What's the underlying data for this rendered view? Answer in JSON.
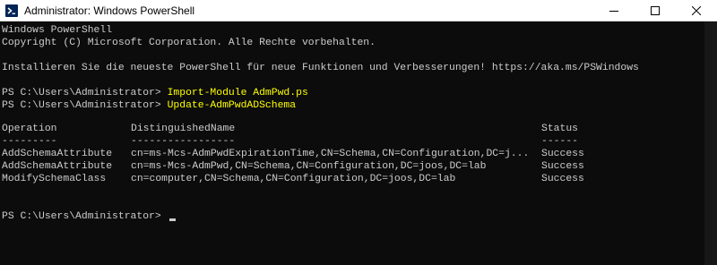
{
  "window": {
    "title": "Administrator: Windows PowerShell",
    "icon": "powershell-icon",
    "controls": [
      "minimize-icon",
      "maximize-icon",
      "close-icon"
    ]
  },
  "colors": {
    "background": "#0c0c0c",
    "text": "#cccccc",
    "command": "#ffff00",
    "icon_blue": "#012456"
  },
  "console": {
    "banner": {
      "line1": "Windows PowerShell",
      "line2": "Copyright (C) Microsoft Corporation. Alle Rechte vorbehalten.",
      "line3": "Installieren Sie die neueste PowerShell für neue Funktionen und Verbesserungen! https://aka.ms/PSWindows"
    },
    "prompt": "PS C:\\Users\\Administrator> ",
    "commands": [
      "Import-Module AdmPwd.ps",
      "Update-AdmPwdADSchema"
    ],
    "table": {
      "headers": [
        "Operation",
        "DistinguishedName",
        "Status"
      ],
      "underlines": [
        "---------",
        "-----------------",
        "------"
      ],
      "rows": [
        [
          "AddSchemaAttribute",
          "cn=ms-Mcs-AdmPwdExpirationTime,CN=Schema,CN=Configuration,DC=j...",
          "Success"
        ],
        [
          "AddSchemaAttribute",
          "cn=ms-Mcs-AdmPwd,CN=Schema,CN=Configuration,DC=joos,DC=lab",
          "Success"
        ],
        [
          "ModifySchemaClass",
          "cn=computer,CN=Schema,CN=Configuration,DC=joos,DC=lab",
          "Success"
        ]
      ]
    }
  }
}
